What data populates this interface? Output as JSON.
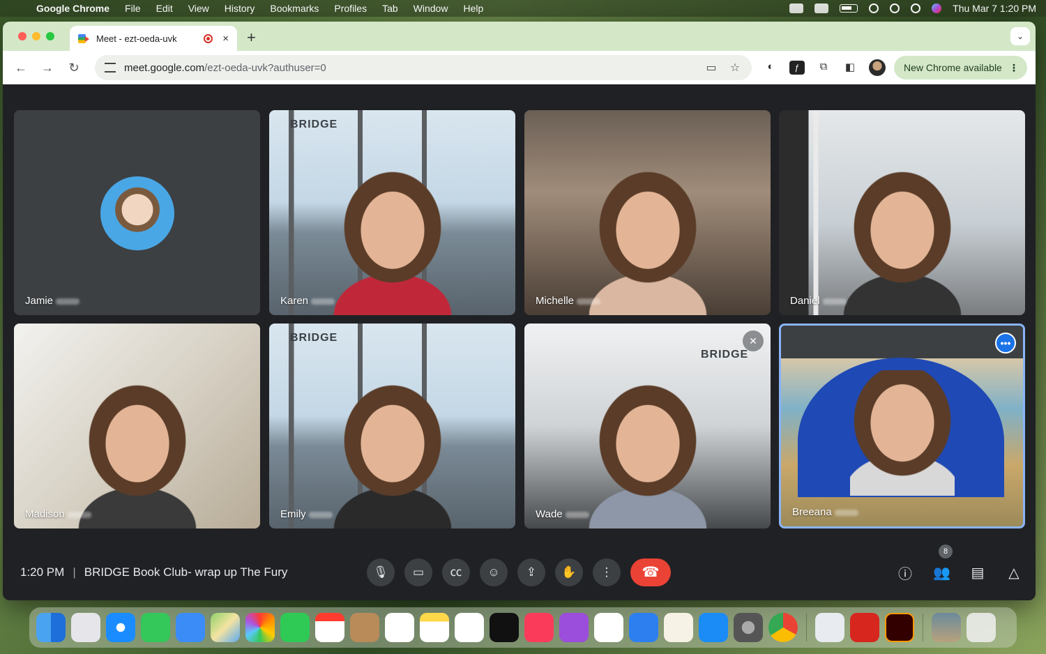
{
  "menubar": {
    "app_name": "Google Chrome",
    "items": [
      "File",
      "Edit",
      "View",
      "History",
      "Bookmarks",
      "Profiles",
      "Tab",
      "Window",
      "Help"
    ],
    "clock": "Thu Mar 7  1:20 PM"
  },
  "browser": {
    "tab_title": "Meet - ezt-oeda-uvk",
    "tab_close": "×",
    "new_tab": "+",
    "url_host": "meet.google.com",
    "url_path": "/ezt-oeda-uvk?authuser=0",
    "update_label": "New Chrome available"
  },
  "participants": [
    {
      "name": "Jamie"
    },
    {
      "name": "Karen",
      "sign": "BRIDGE"
    },
    {
      "name": "Michelle"
    },
    {
      "name": "Daniel"
    },
    {
      "name": "Madison"
    },
    {
      "name": "Emily",
      "sign": "BRIDGE"
    },
    {
      "name": "Wade",
      "sign": "BRIDGE"
    },
    {
      "name": "Breeana"
    }
  ],
  "meeting": {
    "time": "1:20 PM",
    "separator": "|",
    "title": "BRIDGE Book Club- wrap up The Fury",
    "participant_count": "8"
  },
  "colors": {
    "accent": "#8ab4f8",
    "end_call": "#ea4335",
    "update_pill": "#d4e8c8"
  }
}
